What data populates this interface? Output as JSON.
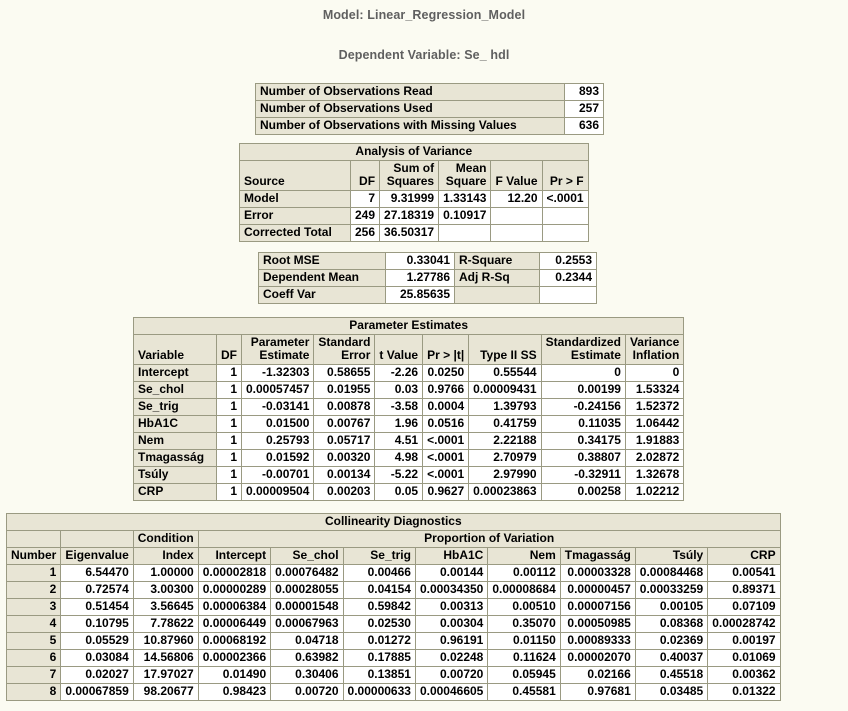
{
  "titles": {
    "model": "Model: Linear_Regression_Model",
    "dependent": "Dependent Variable: Se_ hdl"
  },
  "colors": {
    "page_background": "#FBFBF2",
    "header_background": "#E8E5D5",
    "cell_background": "#FFFFFF",
    "border": "#9A9A82",
    "title_text": "#5F5F5F"
  },
  "observations": {
    "rows": [
      {
        "label": "Number of Observations Read",
        "value": "893"
      },
      {
        "label": "Number of Observations Used",
        "value": "257"
      },
      {
        "label": "Number of Observations with Missing Values",
        "value": "636"
      }
    ]
  },
  "anova": {
    "caption": "Analysis of Variance",
    "headers": [
      "Source",
      "DF",
      "Sum of Squares",
      "Mean Square",
      "F Value",
      "Pr > F"
    ],
    "headers_wrapped": [
      {
        "line1": "",
        "line2": "Source"
      },
      {
        "line1": "",
        "line2": "DF"
      },
      {
        "line1": "Sum of",
        "line2": "Squares"
      },
      {
        "line1": "Mean",
        "line2": "Square"
      },
      {
        "line1": "",
        "line2": "F Value"
      },
      {
        "line1": "",
        "line2": "Pr > F"
      }
    ],
    "rows": [
      {
        "source": "Model",
        "df": "7",
        "ss": "9.31999",
        "ms": "1.33143",
        "f": "12.20",
        "p": "<.0001"
      },
      {
        "source": "Error",
        "df": "249",
        "ss": "27.18319",
        "ms": "0.10917",
        "f": "",
        "p": ""
      },
      {
        "source": "Corrected Total",
        "df": "256",
        "ss": "36.50317",
        "ms": "",
        "f": "",
        "p": ""
      }
    ]
  },
  "fit_statistics": {
    "rows": [
      {
        "label1": "Root MSE",
        "value1": "0.33041",
        "label2": "R-Square",
        "value2": "0.2553"
      },
      {
        "label1": "Dependent Mean",
        "value1": "1.27786",
        "label2": "Adj R-Sq",
        "value2": "0.2344"
      },
      {
        "label1": "Coeff Var",
        "value1": "25.85635",
        "label2": "",
        "value2": ""
      }
    ]
  },
  "parameter_estimates": {
    "caption": "Parameter Estimates",
    "headers_wrapped": [
      {
        "line1": "",
        "line2": "Variable",
        "align": "l"
      },
      {
        "line1": "",
        "line2": "DF",
        "align": "r"
      },
      {
        "line1": "Parameter",
        "line2": "Estimate",
        "align": "r"
      },
      {
        "line1": "Standard",
        "line2": "Error",
        "align": "r"
      },
      {
        "line1": "",
        "line2": "t Value",
        "align": "r"
      },
      {
        "line1": "",
        "line2": "Pr > |t|",
        "align": "r"
      },
      {
        "line1": "",
        "line2": "Type II SS",
        "align": "r"
      },
      {
        "line1": "Standardized",
        "line2": "Estimate",
        "align": "r"
      },
      {
        "line1": "Variance",
        "line2": "Inflation",
        "align": "r"
      }
    ],
    "rows": [
      {
        "variable": "Intercept",
        "df": "1",
        "estimate": "-1.32303",
        "stderr": "0.58655",
        "tvalue": "-2.26",
        "prt": "0.0250",
        "type2ss": "0.55544",
        "stdest": "0",
        "vif": "0"
      },
      {
        "variable": "Se_chol",
        "df": "1",
        "estimate": "0.00057457",
        "stderr": "0.01955",
        "tvalue": "0.03",
        "prt": "0.9766",
        "type2ss": "0.00009431",
        "stdest": "0.00199",
        "vif": "1.53324"
      },
      {
        "variable": "Se_trig",
        "df": "1",
        "estimate": "-0.03141",
        "stderr": "0.00878",
        "tvalue": "-3.58",
        "prt": "0.0004",
        "type2ss": "1.39793",
        "stdest": "-0.24156",
        "vif": "1.52372"
      },
      {
        "variable": "HbA1C",
        "df": "1",
        "estimate": "0.01500",
        "stderr": "0.00767",
        "tvalue": "1.96",
        "prt": "0.0516",
        "type2ss": "0.41759",
        "stdest": "0.11035",
        "vif": "1.06442"
      },
      {
        "variable": "Nem",
        "df": "1",
        "estimate": "0.25793",
        "stderr": "0.05717",
        "tvalue": "4.51",
        "prt": "<.0001",
        "type2ss": "2.22188",
        "stdest": "0.34175",
        "vif": "1.91883"
      },
      {
        "variable": "Tmagasság",
        "df": "1",
        "estimate": "0.01592",
        "stderr": "0.00320",
        "tvalue": "4.98",
        "prt": "<.0001",
        "type2ss": "2.70979",
        "stdest": "0.38807",
        "vif": "2.02872"
      },
      {
        "variable": "Tsúly",
        "df": "1",
        "estimate": "-0.00701",
        "stderr": "0.00134",
        "tvalue": "-5.22",
        "prt": "<.0001",
        "type2ss": "2.97990",
        "stdest": "-0.32911",
        "vif": "1.32678"
      },
      {
        "variable": "CRP",
        "df": "1",
        "estimate": "0.00009504",
        "stderr": "0.00203",
        "tvalue": "0.05",
        "prt": "0.9627",
        "type2ss": "0.00023863",
        "stdest": "0.00258",
        "vif": "1.02212"
      }
    ]
  },
  "collinearity": {
    "caption": "Collinearity Diagnostics",
    "proportion_header": "Proportion of Variation",
    "headers_wrapped": [
      {
        "line1": "",
        "line2": "Number"
      },
      {
        "line1": "",
        "line2": "Eigenvalue"
      },
      {
        "line1": "Condition",
        "line2": "Index"
      },
      {
        "line1": "",
        "line2": "Intercept"
      },
      {
        "line1": "",
        "line2": "Se_chol"
      },
      {
        "line1": "",
        "line2": "Se_trig"
      },
      {
        "line1": "",
        "line2": "HbA1C"
      },
      {
        "line1": "",
        "line2": "Nem"
      },
      {
        "line1": "",
        "line2": "Tmagasság"
      },
      {
        "line1": "",
        "line2": "Tsúly"
      },
      {
        "line1": "",
        "line2": "CRP"
      }
    ],
    "rows": [
      {
        "number": "1",
        "eigenvalue": "6.54470",
        "condition_index": "1.00000",
        "intercept": "0.00002818",
        "se_chol": "0.00076482",
        "se_trig": "0.00466",
        "hba1c": "0.00144",
        "nem": "0.00112",
        "tmagassag": "0.00003328",
        "tsuly": "0.00084468",
        "crp": "0.00541"
      },
      {
        "number": "2",
        "eigenvalue": "0.72574",
        "condition_index": "3.00300",
        "intercept": "0.00000289",
        "se_chol": "0.00028055",
        "se_trig": "0.04154",
        "hba1c": "0.00034350",
        "nem": "0.00008684",
        "tmagassag": "0.00000457",
        "tsuly": "0.00033259",
        "crp": "0.89371"
      },
      {
        "number": "3",
        "eigenvalue": "0.51454",
        "condition_index": "3.56645",
        "intercept": "0.00006384",
        "se_chol": "0.00001548",
        "se_trig": "0.59842",
        "hba1c": "0.00313",
        "nem": "0.00510",
        "tmagassag": "0.00007156",
        "tsuly": "0.00105",
        "crp": "0.07109"
      },
      {
        "number": "4",
        "eigenvalue": "0.10795",
        "condition_index": "7.78622",
        "intercept": "0.00006449",
        "se_chol": "0.00067963",
        "se_trig": "0.02530",
        "hba1c": "0.00304",
        "nem": "0.35070",
        "tmagassag": "0.00050985",
        "tsuly": "0.08368",
        "crp": "0.00028742"
      },
      {
        "number": "5",
        "eigenvalue": "0.05529",
        "condition_index": "10.87960",
        "intercept": "0.00068192",
        "se_chol": "0.04718",
        "se_trig": "0.01272",
        "hba1c": "0.96191",
        "nem": "0.01150",
        "tmagassag": "0.00089333",
        "tsuly": "0.02369",
        "crp": "0.00197"
      },
      {
        "number": "6",
        "eigenvalue": "0.03084",
        "condition_index": "14.56806",
        "intercept": "0.00002366",
        "se_chol": "0.63982",
        "se_trig": "0.17885",
        "hba1c": "0.02248",
        "nem": "0.11624",
        "tmagassag": "0.00002070",
        "tsuly": "0.40037",
        "crp": "0.01069"
      },
      {
        "number": "7",
        "eigenvalue": "0.02027",
        "condition_index": "17.97027",
        "intercept": "0.01490",
        "se_chol": "0.30406",
        "se_trig": "0.13851",
        "hba1c": "0.00720",
        "nem": "0.05945",
        "tmagassag": "0.02166",
        "tsuly": "0.45518",
        "crp": "0.00362"
      },
      {
        "number": "8",
        "eigenvalue": "0.00067859",
        "condition_index": "98.20677",
        "intercept": "0.98423",
        "se_chol": "0.00720",
        "se_trig": "0.00000633",
        "hba1c": "0.00046605",
        "nem": "0.45581",
        "tmagassag": "0.97681",
        "tsuly": "0.03485",
        "crp": "0.01322"
      }
    ]
  }
}
